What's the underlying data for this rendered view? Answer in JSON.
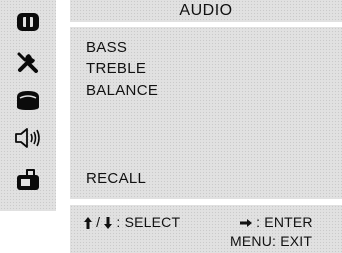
{
  "title": "AUDIO",
  "sidebar": {
    "icons": [
      "picture-icon",
      "tools-icon",
      "tv-icon",
      "speaker-icon",
      "setup-icon"
    ],
    "selected": "speaker-icon"
  },
  "menu": {
    "items": [
      "BASS",
      "TREBLE",
      "BALANCE"
    ],
    "recall": "RECALL"
  },
  "footer": {
    "up_down_label": "SELECT",
    "enter_label": "ENTER",
    "exit_label": "MENU: EXIT"
  }
}
